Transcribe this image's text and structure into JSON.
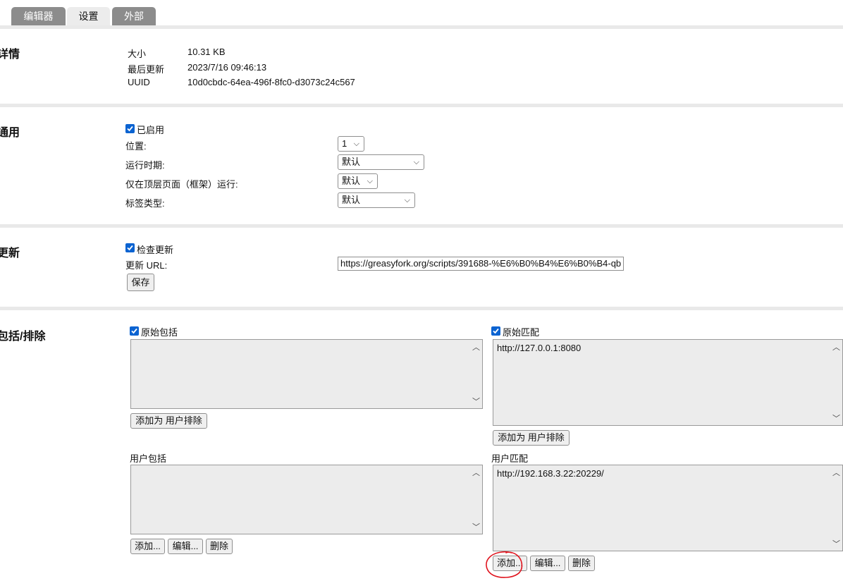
{
  "tabs": [
    {
      "label": "编辑器",
      "active": false
    },
    {
      "label": "设置",
      "active": true
    },
    {
      "label": "外部",
      "active": false
    }
  ],
  "details": {
    "title": "详情",
    "rows": [
      {
        "label": "大小",
        "value": "10.31 KB"
      },
      {
        "label": "最后更新",
        "value": "2023/7/16 09:46:13"
      },
      {
        "label": "UUID",
        "value": "10d0cbdc-64ea-496f-8fc0-d3073c24c567"
      }
    ]
  },
  "general": {
    "title": "通用",
    "enabled_label": "已启用",
    "enabled": true,
    "position_label": "位置:",
    "position_value": "1",
    "run_at_label": "运行时期:",
    "run_at_value": "默认",
    "top_frame_label": "仅在顶层页面（框架）运行:",
    "top_frame_value": "默认",
    "tag_type_label": "标签类型:",
    "tag_type_value": "默认"
  },
  "update": {
    "title": "更新",
    "check_label": "检查更新",
    "check": true,
    "url_label": "更新 URL:",
    "url_value": "https://greasyfork.org/scripts/391688-%E6%B0%B4%E6%B0%B4-qb",
    "save_label": "保存"
  },
  "includes": {
    "title": "包括/排除",
    "original_include_label": "原始包括",
    "original_include_checked": true,
    "original_include_items": [],
    "add_as_user_exclude_label": "添加为 用户排除",
    "original_match_label": "原始匹配",
    "original_match_checked": true,
    "original_match_items": [
      "http://127.0.0.1:8080"
    ],
    "user_include_label": "用户包括",
    "user_include_items": [],
    "user_match_label": "用户匹配",
    "user_match_items": [
      "http://192.168.3.22:20229/"
    ],
    "add_label": "添加...",
    "edit_label": "编辑...",
    "delete_label": "删除"
  },
  "colors": {
    "checkbox": "#0b63d1",
    "tab_inactive": "#8c8c8c",
    "tab_active": "#ececec",
    "annotation": "#e0141e"
  }
}
